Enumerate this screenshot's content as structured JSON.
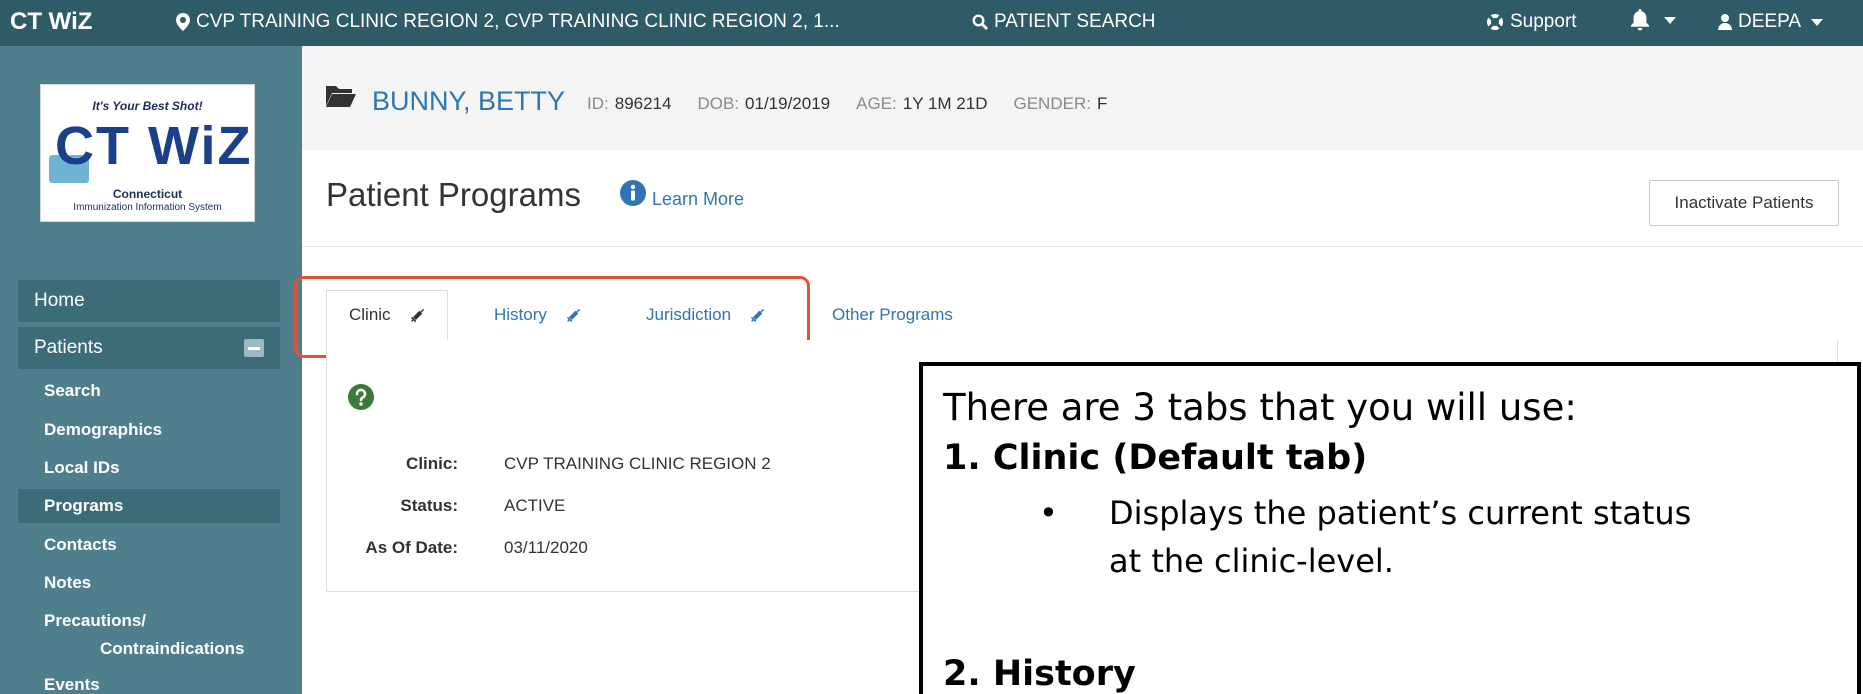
{
  "topbar": {
    "brand": "CT WiZ",
    "location": "CVP TRAINING CLINIC REGION 2, CVP TRAINING CLINIC REGION 2, 1...",
    "patient_search": "PATIENT SEARCH",
    "support": "Support",
    "user": "DEEPA"
  },
  "logo": {
    "tagline": "It's Your Best Shot!",
    "wordmark": "CT WiZ",
    "state": "Connecticut",
    "system": "Immunization Information System"
  },
  "sidebar": {
    "home": "Home",
    "patients": "Patients",
    "items": [
      {
        "label": "Search"
      },
      {
        "label": "Demographics"
      },
      {
        "label": "Local IDs"
      },
      {
        "label": "Programs"
      },
      {
        "label": "Contacts"
      },
      {
        "label": "Notes"
      },
      {
        "label": "Precautions/"
      },
      {
        "label": "Contraindications"
      },
      {
        "label": "Events"
      }
    ]
  },
  "patient": {
    "name": "BUNNY, BETTY",
    "id_label": "ID:",
    "id": "896214",
    "dob_label": "DOB:",
    "dob": "01/19/2019",
    "age_label": "AGE:",
    "age": "1Y 1M 21D",
    "gender_label": "GENDER:",
    "gender": "F"
  },
  "page": {
    "title": "Patient Programs",
    "learn_more": "Learn More",
    "inactivate_button": "Inactivate Patients"
  },
  "tabs": [
    {
      "label": "Clinic"
    },
    {
      "label": "History"
    },
    {
      "label": "Jurisdiction"
    },
    {
      "label": "Other Programs"
    }
  ],
  "details": {
    "clinic_label": "Clinic:",
    "clinic_value": "CVP TRAINING CLINIC REGION 2",
    "status_label": "Status:",
    "status_value": "ACTIVE",
    "asof_label": "As Of Date:",
    "asof_value": "03/11/2020"
  },
  "callout": {
    "intro": "There are 3 tabs that you will use:",
    "item1": "1.  Clinic (Default tab)",
    "bullet": "•",
    "item1_desc_line1": "Displays the patient’s current status",
    "item1_desc_line2": "at the clinic-level.",
    "item2": "2.  History"
  },
  "colors": {
    "topbar": "#2f5a68",
    "sidebar": "#4f7f8d",
    "link": "#2f74b5",
    "highlight": "#e0533a"
  }
}
